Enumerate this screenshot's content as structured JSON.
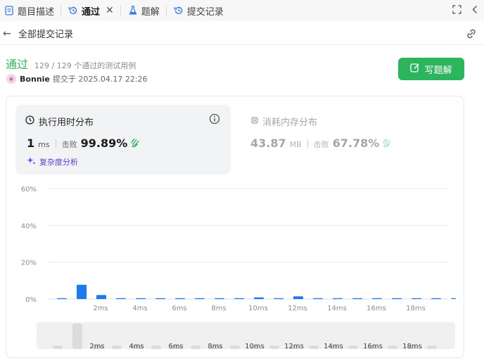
{
  "tabs": [
    {
      "label": "题目描述",
      "icon": "document-icon"
    },
    {
      "label": "通过",
      "icon": "history-icon",
      "active": true
    },
    {
      "label": "题解",
      "icon": "flask-icon"
    },
    {
      "label": "提交记录",
      "icon": "history-icon"
    }
  ],
  "subheader": {
    "back_label": "←",
    "title": "全部提交记录"
  },
  "submission": {
    "status": "通过",
    "cases": "129 / 129 个通过的测试用例",
    "author": "Bonnie",
    "submitted": "提交于 2025.04.17 22:26",
    "solve_button": "写题解"
  },
  "runtime": {
    "label": "执行用时分布",
    "value": "1",
    "unit": "ms",
    "beats_label": "击败",
    "beats": "99.89%",
    "complexity": "复杂度分析"
  },
  "memory": {
    "label": "消耗内存分布",
    "value": "43.87",
    "unit": "MB",
    "beats_label": "击败",
    "beats": "67.78%"
  },
  "colors": {
    "accent": "#2db55d",
    "bar": "#1a7cf0",
    "purple": "#5e3bd6"
  },
  "chart_data": {
    "type": "bar",
    "ylim": [
      0,
      60
    ],
    "yticks": [
      "0%",
      "20%",
      "40%",
      "60%"
    ],
    "xticks": [
      "2ms",
      "4ms",
      "6ms",
      "8ms",
      "10ms",
      "12ms",
      "14ms",
      "16ms",
      "18ms"
    ],
    "values": [
      0.2,
      7.8,
      2.2,
      0.4,
      0.3,
      0.3,
      0.3,
      0.3,
      0.3,
      0.3,
      0.9,
      0.3,
      1.5,
      0.3,
      0.5,
      0.3,
      0.3,
      0.3,
      0.3,
      0.3,
      0.3
    ],
    "highlight_index": 1
  },
  "minimap": {
    "xticks": [
      "2ms",
      "4ms",
      "6ms",
      "8ms",
      "10ms",
      "12ms",
      "14ms",
      "16ms",
      "18ms"
    ],
    "values": [
      0.5,
      13,
      0.5,
      0.5,
      0.5,
      0.5,
      0.5,
      0.5,
      0.5,
      0.5,
      0.5,
      0.5,
      0.5,
      0.5,
      0.5,
      0.5,
      0.5,
      0.5,
      0.5,
      0.5
    ]
  }
}
